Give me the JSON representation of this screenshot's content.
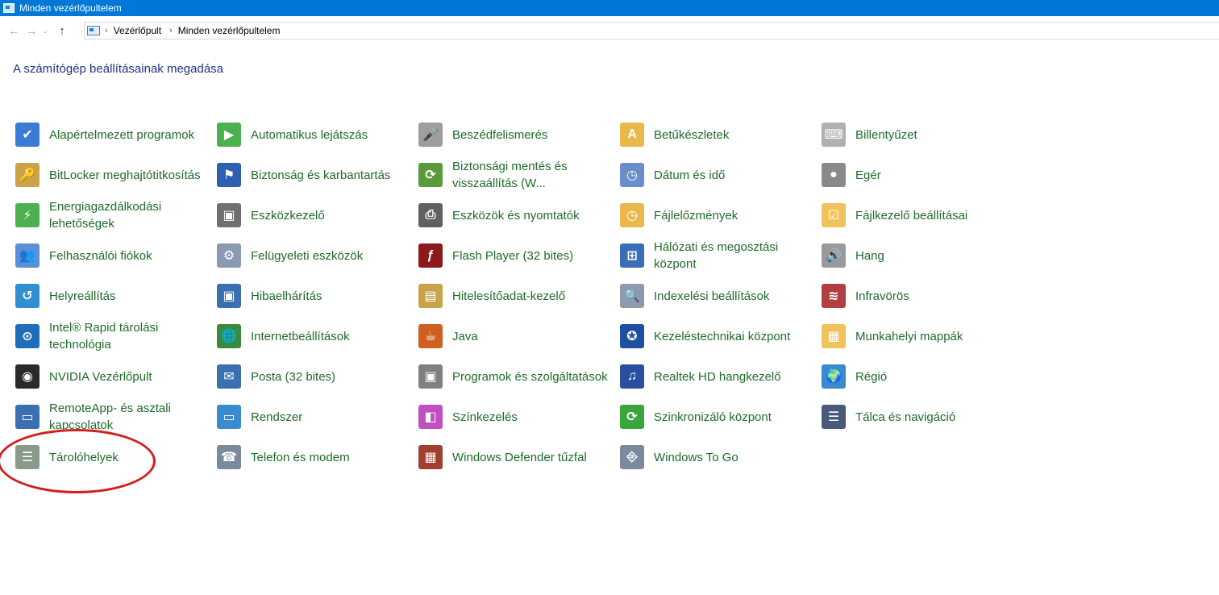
{
  "window": {
    "title": "Minden vezérlőpultelem"
  },
  "nav": {
    "back_glyph": "←",
    "forward_glyph": "→",
    "recent_glyph": "⌄",
    "up_glyph": "↑",
    "breadcrumb": [
      "Vezérlőpult",
      "Minden vezérlőpultelem"
    ],
    "separator": "›"
  },
  "heading": "A számítógép beállításainak megadása",
  "items": [
    {
      "label": "Alapértelmezett programok",
      "icon": "default-programs-icon",
      "color": "#3a7bd5",
      "glyph": "✔"
    },
    {
      "label": "Automatikus lejátszás",
      "icon": "autoplay-icon",
      "color": "#4caf50",
      "glyph": "▶"
    },
    {
      "label": "Beszédfelismerés",
      "icon": "microphone-icon",
      "color": "#9e9e9e",
      "glyph": "🎤"
    },
    {
      "label": "Betűkészletek",
      "icon": "fonts-icon",
      "color": "#e8b84a",
      "glyph": "A"
    },
    {
      "label": "Billentyűzet",
      "icon": "keyboard-icon",
      "color": "#b0b0b0",
      "glyph": "⌨"
    },
    {
      "label": "BitLocker meghajtótitkosítás",
      "icon": "bitlocker-icon",
      "color": "#c9a24a",
      "glyph": "🔑"
    },
    {
      "label": "Biztonság és karbantartás",
      "icon": "flag-icon",
      "color": "#2f5fb0",
      "glyph": "⚑"
    },
    {
      "label": "Biztonsági mentés és visszaállítás (W...",
      "icon": "backup-icon",
      "color": "#5a9a3a",
      "glyph": "⟳"
    },
    {
      "label": "Dátum és idő",
      "icon": "calendar-clock-icon",
      "color": "#6a8fc8",
      "glyph": "◷"
    },
    {
      "label": "Egér",
      "icon": "mouse-icon",
      "color": "#8a8a8a",
      "glyph": "●"
    },
    {
      "label": "Energiagazdálkodási lehetőségek",
      "icon": "power-options-icon",
      "color": "#4caf50",
      "glyph": "⚡"
    },
    {
      "label": "Eszközkezelő",
      "icon": "device-manager-icon",
      "color": "#707070",
      "glyph": "▣"
    },
    {
      "label": "Eszközök és nyomtatók",
      "icon": "printer-icon",
      "color": "#606060",
      "glyph": "⎙"
    },
    {
      "label": "Fájlelőzmények",
      "icon": "file-history-icon",
      "color": "#e8b84a",
      "glyph": "◷"
    },
    {
      "label": "Fájlkezelő beállításai",
      "icon": "folder-options-icon",
      "color": "#f0c35a",
      "glyph": "☑"
    },
    {
      "label": "Felhasználói fiókok",
      "icon": "user-accounts-icon",
      "color": "#5b8fd6",
      "glyph": "👥"
    },
    {
      "label": "Felügyeleti eszközök",
      "icon": "admin-tools-icon",
      "color": "#8a9ab0",
      "glyph": "⚙"
    },
    {
      "label": "Flash Player (32 bites)",
      "icon": "flash-player-icon",
      "color": "#8b1a1a",
      "glyph": "ƒ"
    },
    {
      "label": "Hálózati és megosztási központ",
      "icon": "network-icon",
      "color": "#3a6fb8",
      "glyph": "⊞"
    },
    {
      "label": "Hang",
      "icon": "speaker-icon",
      "color": "#9a9a9a",
      "glyph": "🔊"
    },
    {
      "label": "Helyreállítás",
      "icon": "recovery-icon",
      "color": "#2f8fd0",
      "glyph": "↺"
    },
    {
      "label": "Hibaelhárítás",
      "icon": "troubleshoot-icon",
      "color": "#3a70b0",
      "glyph": "▣"
    },
    {
      "label": "Hitelesítőadat-kezelő",
      "icon": "credential-manager-icon",
      "color": "#c9a24a",
      "glyph": "▤"
    },
    {
      "label": "Indexelési beállítások",
      "icon": "indexing-icon",
      "color": "#8a9ab0",
      "glyph": "🔍"
    },
    {
      "label": "Infravörös",
      "icon": "infrared-icon",
      "color": "#b04040",
      "glyph": "≋"
    },
    {
      "label": "Intel® Rapid tárolási technológia",
      "icon": "intel-rst-icon",
      "color": "#1f6fb8",
      "glyph": "⊙"
    },
    {
      "label": "Internetbeállítások",
      "icon": "internet-options-icon",
      "color": "#3a8a3a",
      "glyph": "🌐"
    },
    {
      "label": "Java",
      "icon": "java-icon",
      "color": "#d06020",
      "glyph": "☕"
    },
    {
      "label": "Kezeléstechnikai központ",
      "icon": "ease-of-access-icon",
      "color": "#1e4fa0",
      "glyph": "✪"
    },
    {
      "label": "Munkahelyi mappák",
      "icon": "work-folders-icon",
      "color": "#f0c35a",
      "glyph": "▦"
    },
    {
      "label": "NVIDIA Vezérlőpult",
      "icon": "nvidia-icon",
      "color": "#2a2a2a",
      "glyph": "◉"
    },
    {
      "label": "Posta (32 bites)",
      "icon": "mail-icon",
      "color": "#3a70b0",
      "glyph": "✉"
    },
    {
      "label": "Programok és szolgáltatások",
      "icon": "programs-features-icon",
      "color": "#808080",
      "glyph": "▣"
    },
    {
      "label": "Realtek HD hangkezelő",
      "icon": "realtek-icon",
      "color": "#2a4fa0",
      "glyph": "♫"
    },
    {
      "label": "Régió",
      "icon": "region-icon",
      "color": "#3a8ad0",
      "glyph": "🌍"
    },
    {
      "label": "RemoteApp- és asztali kapcsolatok",
      "icon": "remoteapp-icon",
      "color": "#3a70b0",
      "glyph": "▭"
    },
    {
      "label": "Rendszer",
      "icon": "system-icon",
      "color": "#3a8ad0",
      "glyph": "▭"
    },
    {
      "label": "Színkezelés",
      "icon": "color-management-icon",
      "color": "#c050c0",
      "glyph": "◧"
    },
    {
      "label": "Szinkronizáló központ",
      "icon": "sync-center-icon",
      "color": "#3aa53a",
      "glyph": "⟳"
    },
    {
      "label": "Tálca és navigáció",
      "icon": "taskbar-icon",
      "color": "#4a5a7a",
      "glyph": "☰"
    },
    {
      "label": "Tárolóhelyek",
      "icon": "storage-spaces-icon",
      "color": "#8a9a8a",
      "glyph": "☰"
    },
    {
      "label": "Telefon és modem",
      "icon": "phone-modem-icon",
      "color": "#7a8a9a",
      "glyph": "☎"
    },
    {
      "label": "Windows Defender tűzfal",
      "icon": "firewall-icon",
      "color": "#a04030",
      "glyph": "▦"
    },
    {
      "label": "Windows To Go",
      "icon": "windows-to-go-icon",
      "color": "#7a8a9a",
      "glyph": "⎆"
    }
  ],
  "highlight_color": "#d21e1e"
}
